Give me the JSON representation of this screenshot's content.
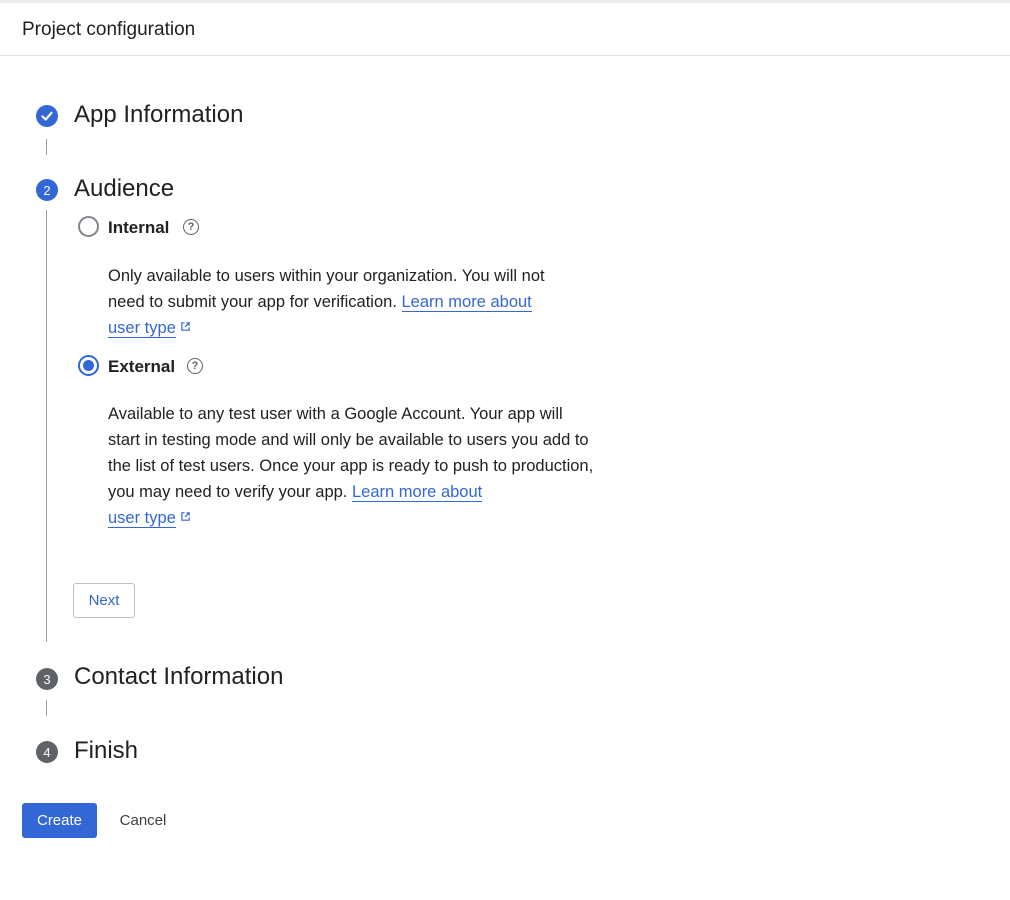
{
  "header": {
    "title": "Project configuration"
  },
  "steps": [
    {
      "number": "1",
      "title": "App Information",
      "state": "done"
    },
    {
      "number": "2",
      "title": "Audience",
      "state": "active"
    },
    {
      "number": "3",
      "title": "Contact Information",
      "state": "pending"
    },
    {
      "number": "4",
      "title": "Finish",
      "state": "pending"
    }
  ],
  "audience": {
    "options": [
      {
        "label": "Internal",
        "selected": false,
        "description": "Only available to users within your organization. You will not need to submit your app for verification.",
        "link_part1": "Learn more about",
        "link_part2": "user type"
      },
      {
        "label": "External",
        "selected": true,
        "description": "Available to any test user with a Google Account. Your app will start in testing mode and will only be available to users you add to the list of test users. Once your app is ready to push to production, you may need to verify your app.",
        "link_part1": "Learn more about",
        "link_part2": "user type"
      }
    ],
    "help_glyph": "?",
    "next_label": "Next"
  },
  "footer": {
    "create_label": "Create",
    "cancel_label": "Cancel"
  },
  "colors": {
    "accent": "#3367d6",
    "pending_step": "#5f6368",
    "text": "#202124"
  },
  "icons": {
    "done_step": "check-icon",
    "help": "help-circle-icon",
    "external_link": "external-link-icon"
  }
}
